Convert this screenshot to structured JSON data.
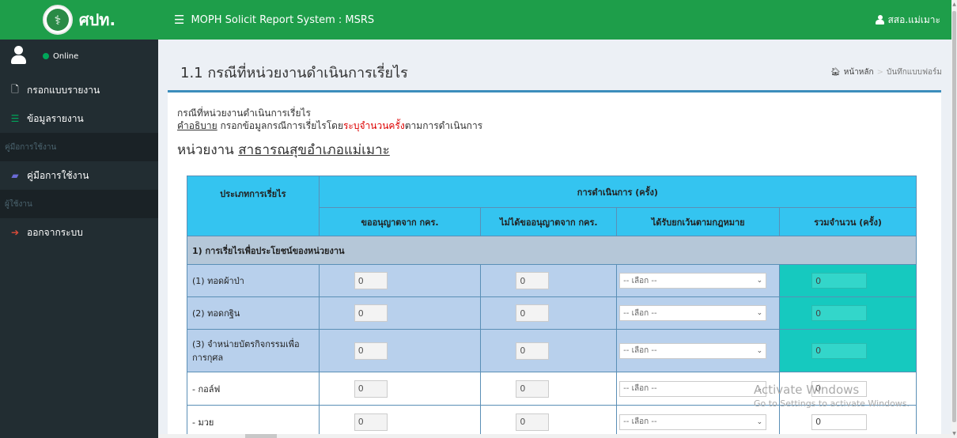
{
  "logo": {
    "text": "ศปท."
  },
  "user_panel": {
    "status": "Online"
  },
  "sidebar": {
    "items": [
      {
        "label": "กรอกแบบรายงาน",
        "icon": "file-icon"
      },
      {
        "label": "ข้อมูลรายงาน",
        "icon": "list-icon"
      }
    ],
    "header_manual": "คู่มือการใช้งาน",
    "manual_item": {
      "label": "คู่มือการใช้งาน",
      "icon": "book-icon"
    },
    "header_user": "ผู้ใช้งาน",
    "logout_item": {
      "label": "ออกจากระบบ",
      "icon": "sign-out-icon"
    }
  },
  "header": {
    "title": "MOPH Solicit Report System : MSRS",
    "user": "สสอ.แม่เมาะ"
  },
  "page": {
    "title": "1.1 กรณีที่หน่วยงานดำเนินการเรี่ยไร",
    "breadcrumb_home": "หน้าหลัก",
    "breadcrumb_current": "บันทึกแบบฟอร์ม"
  },
  "description": {
    "title": "กรณีที่หน่วยงานดำเนินการเรี่ยไร",
    "label": "คำอธิบาย",
    "text_before": " กรอกข้อมูลกรณีการเรี่ยไรโดย",
    "text_red": "ระบุจำนวนครั้ง",
    "text_after": "ตามการดำเนินการ"
  },
  "unit": {
    "prefix": "หน่วยงาน ",
    "name": "สาธารณสุขอำเภอแม่เมาะ"
  },
  "table": {
    "col_type": "ประเภทการเรี่ยไร",
    "col_group": "การดำเนินการ (ครั้ง)",
    "sub_headers": [
      "ขออนุญาตจาก กคร.",
      "ไม่ได้ขออนุญาตจาก กคร.",
      "ได้รับยกเว้นตามกฎหมาย",
      "รวมจำนวน (ครั้ง)"
    ],
    "section_1": "1) การเรี่ยไรเพื่อประโยชน์ของหน่วยงาน",
    "rows": [
      {
        "label": "(1) ทอดผ้าป่า",
        "approved": "0",
        "not_approved": "0",
        "exempt": "-- เลือก --",
        "total": "0"
      },
      {
        "label": "(2) ทอดกฐิน",
        "approved": "0",
        "not_approved": "0",
        "exempt": "-- เลือก --",
        "total": "0"
      },
      {
        "label": "(3) จำหน่ายบัตรกิจกรรมเพื่อการกุศล",
        "approved": "0",
        "not_approved": "0",
        "exempt": "-- เลือก --",
        "total": "0"
      },
      {
        "label": "- กอล์ฟ",
        "approved": "0",
        "not_approved": "0",
        "exempt": "-- เลือก --",
        "total": "0"
      },
      {
        "label": "- มวย",
        "approved": "0",
        "not_approved": "0",
        "exempt": "-- เลือก --",
        "total": "0"
      }
    ]
  },
  "watermark": {
    "line1": "Activate Windows",
    "line2": "Go to Settings to activate Windows."
  },
  "colors": {
    "topbar": "#1e9e4a",
    "sidebar": "#222d32",
    "table_header": "#34c4f0",
    "section_row": "#b5c7d8",
    "blue_row": "#b8d0ec",
    "total_cell": "#16c9bf",
    "description_highlight": "#dd0000"
  }
}
